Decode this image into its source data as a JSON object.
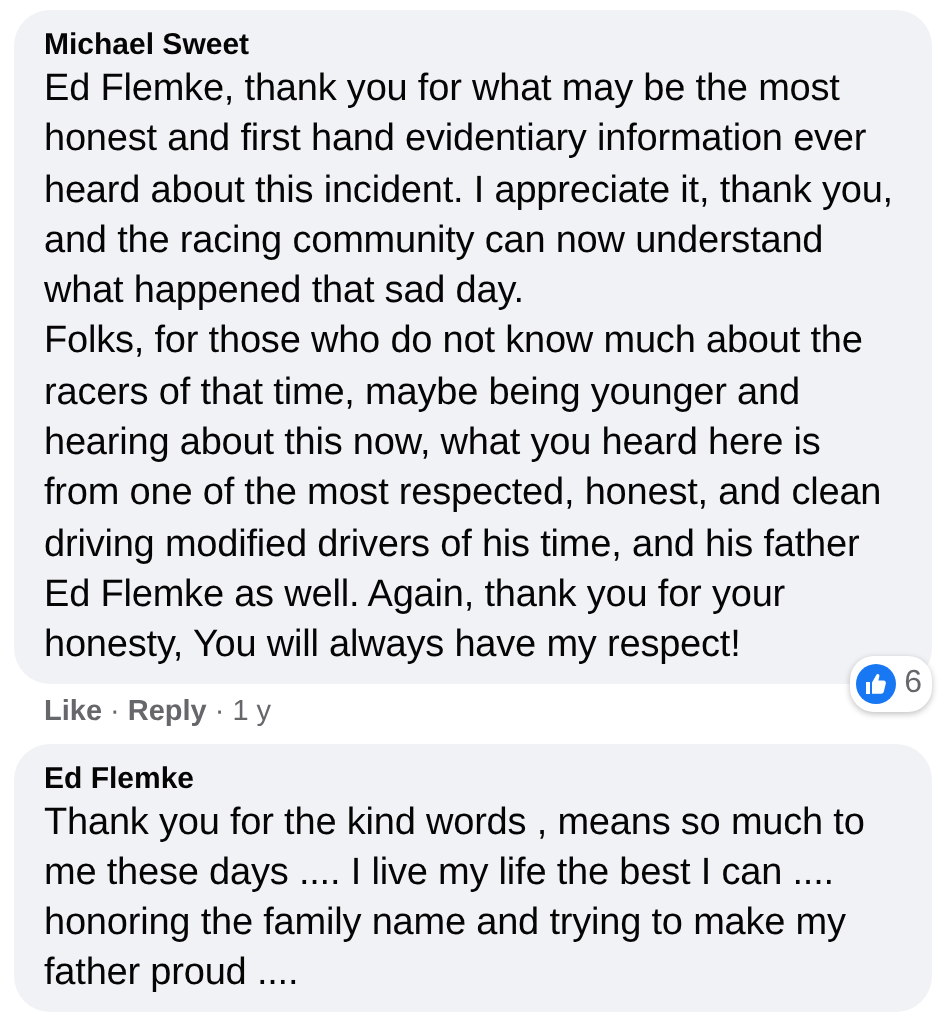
{
  "comments": [
    {
      "author": "Michael Sweet",
      "paragraphs": [
        "Ed Flemke, thank you for what may be the most honest and first hand evidentiary information ever heard about this incident. I appreciate it, thank you, and the racing community can now understand what happened that sad day.",
        "Folks, for those who do not know much about the racers of that time, maybe being younger and hearing about this now, what you heard here is from one of the most respected, honest, and clean driving modified drivers of his time, and his father Ed Flemke as well. Again, thank you for your honesty, You will always have my respect!"
      ],
      "reactions": {
        "count": "6"
      },
      "actions": {
        "like": "Like",
        "sep1": "·",
        "reply": "Reply",
        "sep2": "·",
        "time": "1 y"
      }
    },
    {
      "author": "Ed Flemke",
      "paragraphs": [
        "Thank you for the kind words , means so much to me these days .... I live my life the best I can .... honoring the family name and trying to make my father proud ...."
      ]
    }
  ]
}
